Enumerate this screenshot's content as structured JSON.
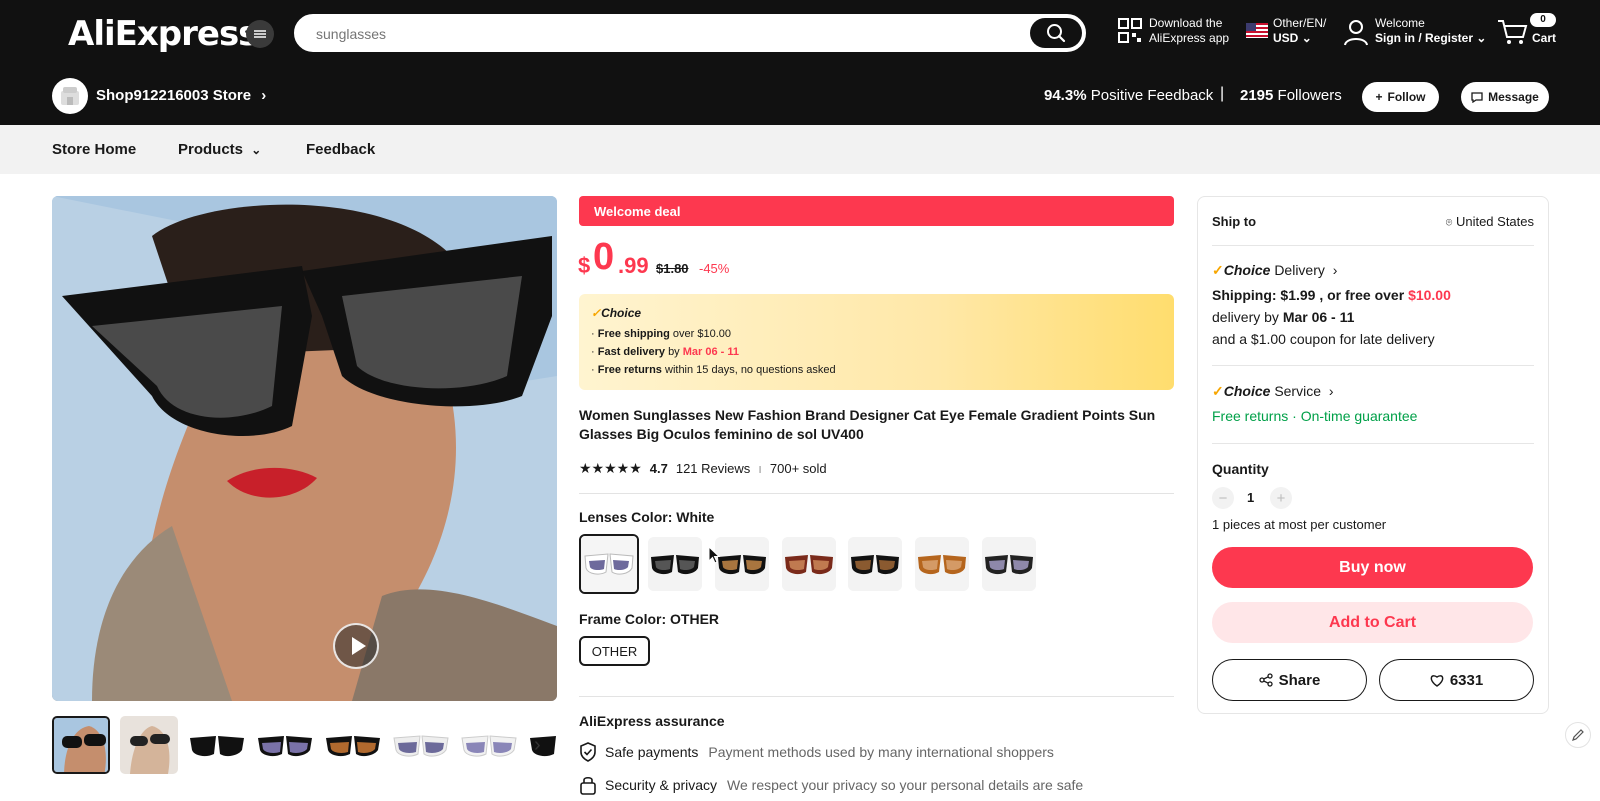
{
  "header": {
    "logo": "AliExpress",
    "search_placeholder": "sunglasses",
    "download_line1": "Download the",
    "download_line2": "AliExpress app",
    "locale_line1": "Other/EN/",
    "locale_line2": "USD",
    "account_line1": "Welcome",
    "account_line2": "Sign in / Register",
    "cart_count": "0",
    "cart_label": "Cart"
  },
  "store": {
    "name": "Shop912216003 Store",
    "feedback_pct": "94.3%",
    "feedback_label": "Positive Feedback",
    "separator": "|",
    "followers_count": "2195",
    "followers_label": "Followers",
    "follow_label": "Follow",
    "message_label": "Message"
  },
  "nav": {
    "items": [
      "Store Home",
      "Products",
      "Feedback"
    ]
  },
  "product": {
    "deal_banner": "Welcome deal",
    "price_currency": "$",
    "price_int": "0",
    "price_dec": ".99",
    "price_old": "$1.80",
    "discount": "-45%",
    "choice": {
      "logo": "Choice",
      "line1_bold": "Free shipping",
      "line1_rest": "over $10.00",
      "line2_bold": "Fast delivery",
      "line2_mid": "by",
      "line2_date": "Mar 06 - 11",
      "line3_bold": "Free returns",
      "line3_rest": "within 15 days, no questions asked"
    },
    "title": "Women Sunglasses New Fashion Brand Designer Cat Eye Female Gradient Points Sun Glasses Big Oculos feminino de sol UV400",
    "rating": "4.7",
    "reviews": "121 Reviews",
    "sold": "700+ sold",
    "lens_label": "Lenses Color: White",
    "frame_label": "Frame Color: OTHER",
    "frame_option": "OTHER",
    "assurance_title": "AliExpress assurance",
    "assurance": [
      {
        "title": "Safe payments",
        "desc": "Payment methods used by many international shoppers"
      },
      {
        "title": "Security & privacy",
        "desc": "We respect your privacy so your personal details are safe"
      }
    ]
  },
  "panel": {
    "ship_to_label": "Ship to",
    "ship_to_value": "United States",
    "choice_delivery_brand": "Choice",
    "choice_delivery_label": "Delivery",
    "shipping_text": "Shipping: $1.99 , or free over",
    "shipping_threshold": "$10.00",
    "delivery_prefix": "delivery by",
    "delivery_date": "Mar 06 - 11",
    "coupon_text": "and a $1.00 coupon for late delivery",
    "choice_service_brand": "Choice",
    "choice_service_label": "Service",
    "free_returns": "Free returns",
    "ontime": "On-time guarantee",
    "quantity_label": "Quantity",
    "quantity_value": "1",
    "limit_text": "1 pieces at most per customer",
    "buy_now": "Buy now",
    "add_to_cart": "Add to Cart",
    "share": "Share",
    "wishlist_count": "6331"
  },
  "colors": {
    "brand_red": "#fd384f",
    "header_bg": "#111111",
    "green": "#00a048"
  }
}
